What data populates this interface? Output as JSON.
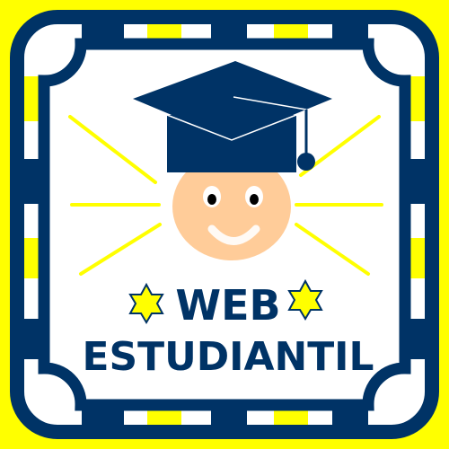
{
  "logo": {
    "line1": "WEB",
    "line2": "ESTUDIANTIL"
  },
  "colors": {
    "navy": "#003366",
    "yellow": "#ffff00",
    "skin": "#ffcc99",
    "white": "#ffffff"
  },
  "icons": [
    "graduation-cap-icon",
    "smiling-face-icon",
    "star-icon"
  ]
}
